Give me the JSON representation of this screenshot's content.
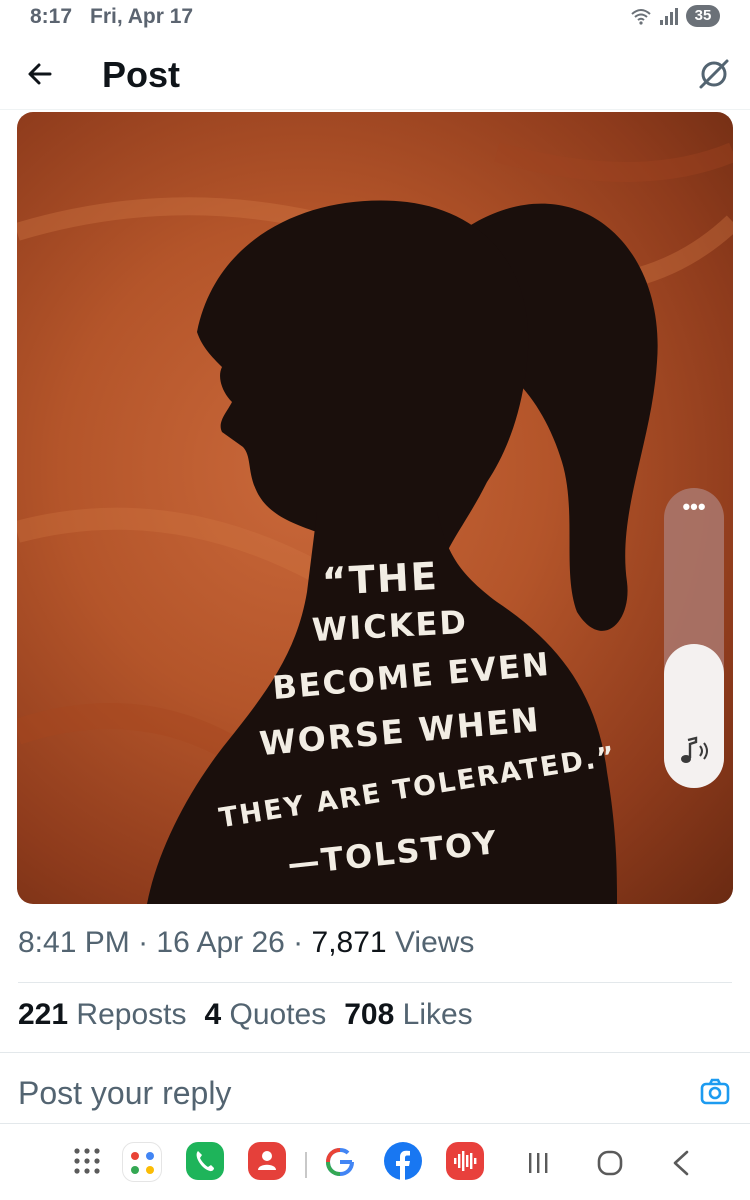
{
  "status_bar": {
    "time": "8:17",
    "date": "Fri, Apr 17",
    "battery": "35",
    "icons": [
      "wifi-icon",
      "signal-icon",
      "battery-icon"
    ]
  },
  "header": {
    "title": "Post",
    "back_icon": "arrow-left-icon",
    "grok_icon": "grok-icon"
  },
  "media": {
    "quote_lines": [
      "“THE",
      "WICKED",
      "BECOME EVEN",
      "WORSE WHEN",
      "THEY ARE TOLERATED.”",
      "—TOLSTOY"
    ],
    "colors": {
      "background": "#b4552a",
      "silhouette": "#1a0f0c",
      "text": "#f2ede4"
    }
  },
  "volume_overlay": {
    "more_label": "•••",
    "level": 0.48,
    "icon": "music-note-volume-icon"
  },
  "meta": {
    "time": "8:41 PM",
    "separator": " · ",
    "date": "16 Apr 26",
    "views_count": "7,871",
    "views_label": "Views"
  },
  "stats": {
    "reposts_count": "221",
    "reposts_label": "Reposts",
    "quotes_count": "4",
    "quotes_label": "Quotes",
    "likes_count": "708",
    "likes_label": "Likes"
  },
  "reply": {
    "placeholder": "Post your reply",
    "camera_icon": "camera-icon"
  },
  "taskbar": {
    "apps": [
      "app-grid-icon",
      "app-folder-icon",
      "phone-app-icon",
      "contacts-app-icon",
      "google-app-icon",
      "facebook-app-icon",
      "recorder-app-icon"
    ],
    "nav": [
      "recents-button-icon",
      "home-button-icon",
      "back-nav-icon"
    ],
    "accent": "#1d9bf0"
  }
}
